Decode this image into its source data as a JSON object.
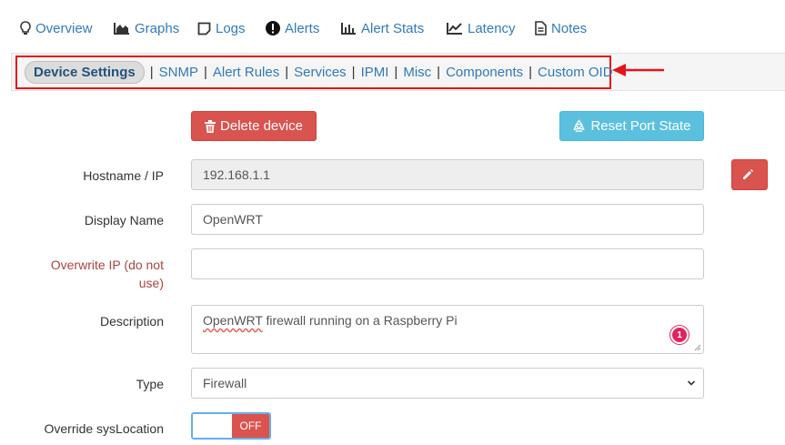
{
  "tabs": [
    {
      "label": "Overview",
      "icon": "lightbulb-icon"
    },
    {
      "label": "Graphs",
      "icon": "area-chart-icon"
    },
    {
      "label": "Logs",
      "icon": "sticky-note-icon"
    },
    {
      "label": "Alerts",
      "icon": "exclamation-circle-icon"
    },
    {
      "label": "Alert Stats",
      "icon": "bar-chart-icon"
    },
    {
      "label": "Latency",
      "icon": "line-chart-icon"
    },
    {
      "label": "Notes",
      "icon": "file-text-icon"
    }
  ],
  "subnav": {
    "active": "Device Settings",
    "links": [
      "SNMP",
      "Alert Rules",
      "Services",
      "IPMI",
      "Misc",
      "Components",
      "Custom OID"
    ],
    "separator": "|"
  },
  "actions": {
    "delete_label": "Delete device",
    "reset_label": "Reset Port State"
  },
  "form": {
    "hostname": {
      "label": "Hostname / IP",
      "value": "192.168.1.1"
    },
    "display_name": {
      "label": "Display Name",
      "value": "OpenWRT"
    },
    "overwrite_ip": {
      "label_line1": "Overwrite IP (do not",
      "label_line2": "use)",
      "value": ""
    },
    "description": {
      "label": "Description",
      "value_word1": "OpenWRT",
      "value_rest": " firewall running on a Raspberry Pi",
      "badge": "1"
    },
    "type": {
      "label": "Type",
      "value": "Firewall"
    },
    "override_syslocation": {
      "label": "Override sysLocation",
      "state": "OFF"
    }
  },
  "colors": {
    "link": "#337ab7",
    "danger": "#d9534f",
    "info": "#5bc0de",
    "highlight": "#e6141b"
  }
}
